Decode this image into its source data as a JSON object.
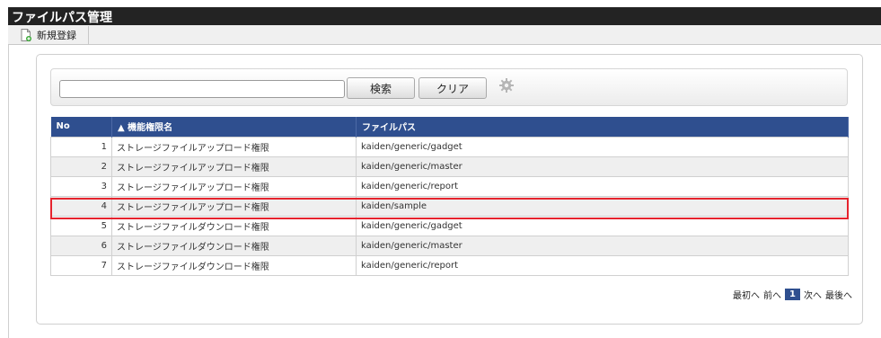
{
  "page": {
    "title": "ファイルパス管理"
  },
  "toolbar": {
    "new_label": "新規登録",
    "new_icon": "new-document-icon"
  },
  "search": {
    "value": "",
    "placeholder": "",
    "search_label": "検索",
    "clear_label": "クリア",
    "settings_icon": "gear-icon"
  },
  "table": {
    "headers": {
      "no": "No",
      "name": "▲ 機能権限名",
      "path": "ファイルパス"
    },
    "rows": [
      {
        "no": "1",
        "name": "ストレージファイルアップロード権限",
        "path": "kaiden/generic/gadget"
      },
      {
        "no": "2",
        "name": "ストレージファイルアップロード権限",
        "path": "kaiden/generic/master"
      },
      {
        "no": "3",
        "name": "ストレージファイルアップロード権限",
        "path": "kaiden/generic/report"
      },
      {
        "no": "4",
        "name": "ストレージファイルアップロード権限",
        "path": "kaiden/sample"
      },
      {
        "no": "5",
        "name": "ストレージファイルダウンロード権限",
        "path": "kaiden/generic/gadget"
      },
      {
        "no": "6",
        "name": "ストレージファイルダウンロード権限",
        "path": "kaiden/generic/master"
      },
      {
        "no": "7",
        "name": "ストレージファイルダウンロード権限",
        "path": "kaiden/generic/report"
      }
    ],
    "highlighted_row": 4
  },
  "pager": {
    "first": "最初へ",
    "prev": "前へ",
    "current": "1",
    "next": "次へ",
    "last": "最後へ"
  },
  "colors": {
    "header": "#2f4f8f",
    "titlebar": "#232323",
    "highlight": "#e5232d"
  }
}
